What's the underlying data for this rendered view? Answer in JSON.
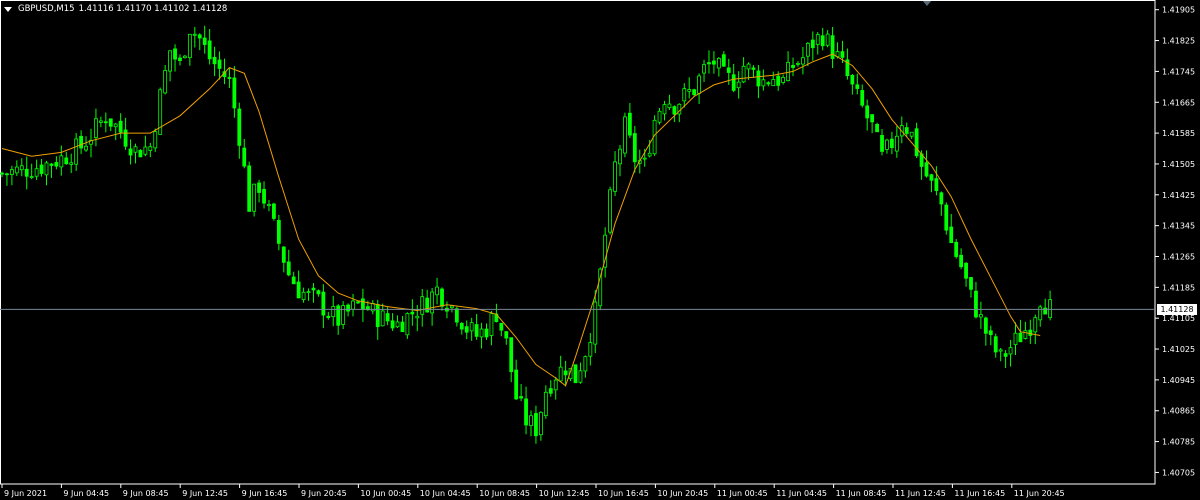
{
  "header": {
    "symbol_timeframe": "GBPUSD,M15",
    "ohlc": "1.41116 1.41170 1.41102 1.41128"
  },
  "colors": {
    "background": "#000000",
    "frame": "#ffffff",
    "bull_candle": "#00ff00",
    "bear_candle": "#00ff00",
    "moving_average": "#f0a000",
    "bid_line": "#778899",
    "text": "#ffffff"
  },
  "current_price": "1.41128",
  "chart_data": {
    "type": "candlestick",
    "title": "GBPUSD,M15",
    "ylim": [
      1.40675,
      1.41925
    ],
    "y_ticks": [
      "1.41905",
      "1.41825",
      "1.41745",
      "1.41665",
      "1.41585",
      "1.41505",
      "1.41425",
      "1.41345",
      "1.41265",
      "1.41185",
      "1.41105",
      "1.41025",
      "1.40945",
      "1.40865",
      "1.40785",
      "1.40705"
    ],
    "x_ticks": [
      "9 Jun 2021",
      "9 Jun 04:45",
      "9 Jun 08:45",
      "9 Jun 12:45",
      "9 Jun 16:45",
      "9 Jun 20:45",
      "10 Jun 00:45",
      "10 Jun 04:45",
      "10 Jun 08:45",
      "10 Jun 12:45",
      "10 Jun 16:45",
      "10 Jun 20:45",
      "11 Jun 00:45",
      "11 Jun 04:45",
      "11 Jun 08:45",
      "11 Jun 12:45",
      "11 Jun 16:45",
      "11 Jun 20:45"
    ],
    "close_path": [
      [
        0,
        1.4148
      ],
      [
        4,
        1.4149
      ],
      [
        8,
        1.415
      ],
      [
        12,
        1.4152
      ],
      [
        16,
        1.4155
      ],
      [
        18,
        1.4158
      ],
      [
        21,
        1.4163
      ],
      [
        24,
        1.4159
      ],
      [
        27,
        1.4154
      ],
      [
        30,
        1.4155
      ],
      [
        32,
        1.4168
      ],
      [
        34,
        1.418
      ],
      [
        36,
        1.4176
      ],
      [
        38,
        1.4186
      ],
      [
        40,
        1.4183
      ],
      [
        42,
        1.4178
      ],
      [
        44,
        1.4175
      ],
      [
        46,
        1.4172
      ],
      [
        48,
        1.4158
      ],
      [
        50,
        1.414
      ],
      [
        52,
        1.4145
      ],
      [
        54,
        1.4138
      ],
      [
        56,
        1.413
      ],
      [
        58,
        1.4122
      ],
      [
        60,
        1.4118
      ],
      [
        62,
        1.4116
      ],
      [
        64,
        1.4115
      ],
      [
        66,
        1.4112
      ],
      [
        68,
        1.411
      ],
      [
        70,
        1.4112
      ],
      [
        72,
        1.4114
      ],
      [
        74,
        1.4113
      ],
      [
        76,
        1.4111
      ],
      [
        78,
        1.411
      ],
      [
        80,
        1.4109
      ],
      [
        82,
        1.4111
      ],
      [
        84,
        1.4113
      ],
      [
        86,
        1.4115
      ],
      [
        88,
        1.4118
      ],
      [
        90,
        1.4115
      ],
      [
        92,
        1.4112
      ],
      [
        94,
        1.4108
      ],
      [
        96,
        1.4106
      ],
      [
        98,
        1.4108
      ],
      [
        100,
        1.4112
      ],
      [
        102,
        1.4104
      ],
      [
        104,
        1.409
      ],
      [
        106,
        1.4084
      ],
      [
        108,
        1.4082
      ],
      [
        110,
        1.4092
      ],
      [
        112,
        1.4096
      ],
      [
        114,
        1.4098
      ],
      [
        116,
        1.4095
      ],
      [
        118,
        1.4102
      ],
      [
        120,
        1.4112
      ],
      [
        122,
        1.4132
      ],
      [
        124,
        1.415
      ],
      [
        126,
        1.416
      ],
      [
        128,
        1.4152
      ],
      [
        130,
        1.415
      ],
      [
        132,
        1.4162
      ],
      [
        134,
        1.4168
      ],
      [
        136,
        1.4166
      ],
      [
        138,
        1.4168
      ],
      [
        140,
        1.417
      ],
      [
        142,
        1.4175
      ],
      [
        144,
        1.4177
      ],
      [
        146,
        1.4173
      ],
      [
        148,
        1.4172
      ],
      [
        150,
        1.4176
      ],
      [
        152,
        1.4174
      ],
      [
        154,
        1.4172
      ],
      [
        156,
        1.4173
      ],
      [
        158,
        1.4172
      ],
      [
        160,
        1.4176
      ],
      [
        162,
        1.4178
      ],
      [
        164,
        1.4182
      ],
      [
        166,
        1.4184
      ],
      [
        168,
        1.418
      ],
      [
        170,
        1.4176
      ],
      [
        172,
        1.417
      ],
      [
        174,
        1.4165
      ],
      [
        176,
        1.416
      ],
      [
        178,
        1.4152
      ],
      [
        180,
        1.4156
      ],
      [
        182,
        1.4162
      ],
      [
        184,
        1.4158
      ],
      [
        186,
        1.415
      ],
      [
        188,
        1.4145
      ],
      [
        190,
        1.414
      ],
      [
        192,
        1.413
      ],
      [
        194,
        1.4124
      ],
      [
        196,
        1.4116
      ],
      [
        198,
        1.411
      ],
      [
        200,
        1.4104
      ],
      [
        202,
        1.41
      ],
      [
        204,
        1.4103
      ],
      [
        206,
        1.4106
      ],
      [
        208,
        1.4109
      ],
      [
        210,
        1.4116
      ],
      [
        212,
        1.4113
      ]
    ],
    "ma_path": [
      [
        0,
        1.41545
      ],
      [
        6,
        1.41525
      ],
      [
        12,
        1.41535
      ],
      [
        18,
        1.41565
      ],
      [
        24,
        1.41585
      ],
      [
        30,
        1.41585
      ],
      [
        36,
        1.4163
      ],
      [
        42,
        1.417
      ],
      [
        46,
        1.41755
      ],
      [
        49,
        1.4174
      ],
      [
        52,
        1.4164
      ],
      [
        56,
        1.4147
      ],
      [
        60,
        1.4131
      ],
      [
        64,
        1.41215
      ],
      [
        68,
        1.4117
      ],
      [
        72,
        1.4115
      ],
      [
        78,
        1.41135
      ],
      [
        84,
        1.41125
      ],
      [
        90,
        1.4114
      ],
      [
        96,
        1.4113
      ],
      [
        100,
        1.41115
      ],
      [
        104,
        1.41055
      ],
      [
        108,
        1.40985
      ],
      [
        112,
        1.4095
      ],
      [
        114,
        1.4093
      ],
      [
        116,
        1.41005
      ],
      [
        120,
        1.41165
      ],
      [
        124,
        1.4135
      ],
      [
        128,
        1.4149
      ],
      [
        132,
        1.4158
      ],
      [
        136,
        1.4163
      ],
      [
        140,
        1.4168
      ],
      [
        144,
        1.4171
      ],
      [
        148,
        1.41725
      ],
      [
        152,
        1.4173
      ],
      [
        156,
        1.41735
      ],
      [
        160,
        1.41745
      ],
      [
        164,
        1.4177
      ],
      [
        168,
        1.4179
      ],
      [
        172,
        1.4176
      ],
      [
        176,
        1.417
      ],
      [
        180,
        1.4162
      ],
      [
        184,
        1.4156
      ],
      [
        188,
        1.415
      ],
      [
        192,
        1.4142
      ],
      [
        196,
        1.4131
      ],
      [
        200,
        1.4121
      ],
      [
        204,
        1.4111
      ],
      [
        206,
        1.4107
      ],
      [
        208,
        1.41065
      ],
      [
        210,
        1.4106
      ]
    ]
  }
}
